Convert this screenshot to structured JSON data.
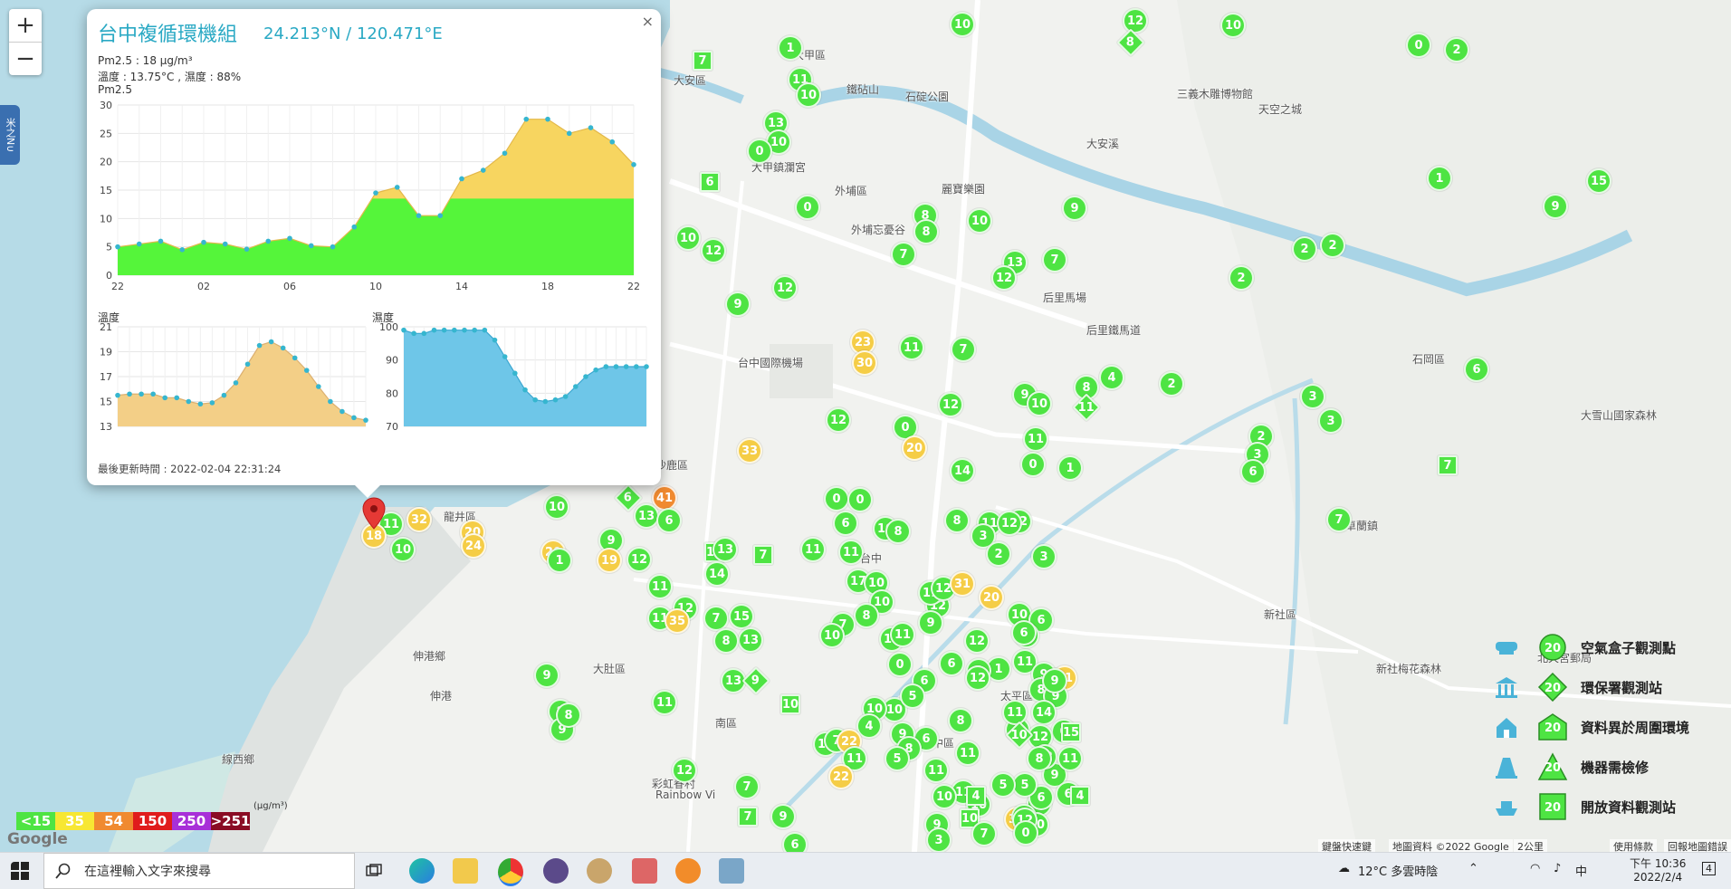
{
  "colors": {
    "green": "#4ee443",
    "yellow": "#f5cd46",
    "orange": "#f08a30",
    "red": "#e01c1c",
    "purple": "#a830d8",
    "maroon": "#8a0c24",
    "accent": "#2aa9c4"
  },
  "zoom": {
    "in": "+",
    "out": "−"
  },
  "side_tab": "米之N∪",
  "popup": {
    "title": "台中複循環機組",
    "coords": "24.213°N / 120.471°E",
    "pm": "Pm2.5 : 18 μg/m³",
    "tempHum": "溫度 : 13.75°C , 濕度 : 88%",
    "pmLabel": "Pm2.5",
    "tempLabel": "溫度",
    "humLabel": "濕度",
    "updated": "最後更新時間 : 2022-02-04 22:31:24",
    "close": "×"
  },
  "chart_data": [
    {
      "type": "area",
      "title": "Pm2.5",
      "ylim": [
        0,
        30
      ],
      "yticks": [
        0,
        5,
        10,
        15,
        20,
        25,
        30
      ],
      "xticks": [
        "22",
        "02",
        "06",
        "10",
        "14",
        "18",
        "22"
      ],
      "threshold": 13.5,
      "values": [
        5,
        5.5,
        6,
        4.5,
        5.8,
        5.5,
        4.6,
        6,
        6.5,
        5.2,
        5,
        8.5,
        14.5,
        15.5,
        10.5,
        10.5,
        17,
        18.5,
        21.5,
        27.5,
        27.5,
        25,
        26,
        23.5,
        19.5
      ]
    },
    {
      "type": "area",
      "title": "溫度",
      "ylim": [
        13,
        21
      ],
      "yticks": [
        13,
        15,
        17,
        19,
        21
      ],
      "values": [
        15.5,
        15.6,
        15.6,
        15.6,
        15.3,
        15.3,
        15,
        14.8,
        14.9,
        15.5,
        16.5,
        18,
        19.5,
        19.8,
        19.3,
        18.5,
        17.5,
        16.2,
        15,
        14.2,
        13.7,
        13.5
      ]
    },
    {
      "type": "area",
      "title": "濕度",
      "ylim": [
        70,
        100
      ],
      "yticks": [
        70,
        80,
        90,
        100
      ],
      "values": [
        99,
        98,
        98,
        99,
        99,
        99,
        99,
        99,
        99,
        96,
        91,
        86,
        81,
        78,
        77.5,
        78,
        79,
        82,
        85,
        87,
        88,
        88,
        88,
        88,
        88
      ]
    }
  ],
  "map_labels": [
    {
      "t": "大甲區"
    },
    {
      "t": "大安區"
    },
    {
      "t": "石岡區"
    },
    {
      "t": "外埔區"
    },
    {
      "t": "后里馬場"
    },
    {
      "t": "后里鐵馬道"
    },
    {
      "t": "台中國際機場"
    },
    {
      "t": "沙鹿區"
    },
    {
      "t": "龍井區"
    },
    {
      "t": "大肚區"
    },
    {
      "t": "伸港鄉"
    },
    {
      "t": "伸港"
    },
    {
      "t": "線西鄉"
    },
    {
      "t": "新社區"
    },
    {
      "t": "卓蘭鎮"
    },
    {
      "t": "彩虹眷村"
    },
    {
      "t": "Rainbow Vi"
    },
    {
      "t": "大雪山國家森林"
    },
    {
      "t": "北天宮郵局"
    },
    {
      "t": "太平區"
    },
    {
      "t": "台中"
    },
    {
      "t": "南區"
    },
    {
      "t": "中區"
    },
    {
      "t": "新社梅花森林"
    },
    {
      "t": "天空之城"
    },
    {
      "t": "三義木雕博物館"
    },
    {
      "t": "大安溪"
    },
    {
      "t": "鐵砧山"
    },
    {
      "t": "石碇公園"
    },
    {
      "t": "外埔忘憂谷"
    },
    {
      "t": "麗寶樂園"
    },
    {
      "t": "大甲鎮瀾宮"
    }
  ],
  "markers": [
    {
      "v": "10",
      "c": "g"
    },
    {
      "v": "7",
      "c": "g",
      "s": "sq"
    },
    {
      "v": "1",
      "c": "g"
    },
    {
      "v": "11",
      "c": "g"
    },
    {
      "v": "10",
      "c": "g"
    },
    {
      "v": "12",
      "c": "g"
    },
    {
      "v": "8",
      "c": "g",
      "s": "dm"
    },
    {
      "v": "10",
      "c": "g"
    },
    {
      "v": "0",
      "c": "g"
    },
    {
      "v": "2",
      "c": "g"
    },
    {
      "v": "13",
      "c": "g"
    },
    {
      "v": "10",
      "c": "g"
    },
    {
      "v": "0",
      "c": "g"
    },
    {
      "v": "6",
      "c": "g",
      "s": "sq"
    },
    {
      "v": "1",
      "c": "g"
    },
    {
      "v": "15",
      "c": "g"
    },
    {
      "v": "9",
      "c": "g"
    },
    {
      "v": "0",
      "c": "g"
    },
    {
      "v": "8",
      "c": "g"
    },
    {
      "v": "10",
      "c": "g"
    },
    {
      "v": "9",
      "c": "g"
    },
    {
      "v": "10",
      "c": "g"
    },
    {
      "v": "12",
      "c": "g"
    },
    {
      "v": "7",
      "c": "g"
    },
    {
      "v": "8",
      "c": "g"
    },
    {
      "v": "13",
      "c": "g"
    },
    {
      "v": "7",
      "c": "g"
    },
    {
      "v": "12",
      "c": "g"
    },
    {
      "v": "2",
      "c": "g"
    },
    {
      "v": "2",
      "c": "g"
    },
    {
      "v": "2",
      "c": "g"
    },
    {
      "v": "9",
      "c": "g"
    },
    {
      "v": "12",
      "c": "g"
    },
    {
      "v": "23",
      "c": "y"
    },
    {
      "v": "30",
      "c": "y"
    },
    {
      "v": "11",
      "c": "g"
    },
    {
      "v": "7",
      "c": "g"
    },
    {
      "v": "6",
      "c": "g"
    },
    {
      "v": "12",
      "c": "g"
    },
    {
      "v": "12",
      "c": "g"
    },
    {
      "v": "0",
      "c": "g"
    },
    {
      "v": "20",
      "c": "y"
    },
    {
      "v": "9",
      "c": "g"
    },
    {
      "v": "10",
      "c": "g"
    },
    {
      "v": "8",
      "c": "g"
    },
    {
      "v": "4",
      "c": "g"
    },
    {
      "v": "11",
      "c": "g",
      "s": "dm"
    },
    {
      "v": "2",
      "c": "g"
    },
    {
      "v": "3",
      "c": "g"
    },
    {
      "v": "3",
      "c": "g"
    },
    {
      "v": "33",
      "c": "y"
    },
    {
      "v": "14",
      "c": "g"
    },
    {
      "v": "11",
      "c": "g"
    },
    {
      "v": "0",
      "c": "g"
    },
    {
      "v": "1",
      "c": "g"
    },
    {
      "v": "2",
      "c": "g"
    },
    {
      "v": "3",
      "c": "g"
    },
    {
      "v": "6",
      "c": "g"
    },
    {
      "v": "7",
      "c": "g",
      "s": "sq"
    },
    {
      "v": "41",
      "c": "o"
    },
    {
      "v": "6",
      "c": "g",
      "s": "dm"
    },
    {
      "v": "13",
      "c": "g"
    },
    {
      "v": "6",
      "c": "g"
    },
    {
      "v": "10",
      "c": "g"
    },
    {
      "v": "0",
      "c": "g"
    },
    {
      "v": "0",
      "c": "g"
    },
    {
      "v": "6",
      "c": "g"
    },
    {
      "v": "12",
      "c": "g"
    },
    {
      "v": "10",
      "c": "g"
    },
    {
      "v": "8",
      "c": "g"
    },
    {
      "v": "8",
      "c": "g"
    },
    {
      "v": "11",
      "c": "g"
    },
    {
      "v": "12",
      "c": "g"
    },
    {
      "v": "3",
      "c": "g"
    },
    {
      "v": "2",
      "c": "g"
    },
    {
      "v": "3",
      "c": "g"
    },
    {
      "v": "7",
      "c": "g"
    },
    {
      "v": "32",
      "c": "y"
    },
    {
      "v": "11",
      "c": "g"
    },
    {
      "v": "18",
      "c": "y"
    },
    {
      "v": "10",
      "c": "g",
      "s": "sq"
    },
    {
      "v": "20",
      "c": "y"
    },
    {
      "v": "24",
      "c": "y"
    },
    {
      "v": "10",
      "c": "g"
    },
    {
      "v": "9",
      "c": "g"
    },
    {
      "v": "20",
      "c": "y"
    },
    {
      "v": "19",
      "c": "y"
    },
    {
      "v": "13",
      "c": "g"
    },
    {
      "v": "14",
      "c": "g"
    },
    {
      "v": "7",
      "c": "g",
      "s": "sq"
    },
    {
      "v": "1",
      "c": "g"
    },
    {
      "v": "12",
      "c": "g"
    },
    {
      "v": "11",
      "c": "g"
    },
    {
      "v": "12",
      "c": "g"
    },
    {
      "v": "11",
      "c": "g"
    },
    {
      "v": "12",
      "c": "g"
    },
    {
      "v": "11",
      "c": "g"
    },
    {
      "v": "35",
      "c": "y"
    },
    {
      "v": "7",
      "c": "g"
    },
    {
      "v": "15",
      "c": "g"
    },
    {
      "v": "13",
      "c": "g"
    },
    {
      "v": "8",
      "c": "g"
    },
    {
      "v": "11",
      "c": "g"
    },
    {
      "v": "17",
      "c": "g"
    },
    {
      "v": "10",
      "c": "g"
    },
    {
      "v": "10",
      "c": "g"
    },
    {
      "v": "8",
      "c": "g"
    },
    {
      "v": "7",
      "c": "g"
    },
    {
      "v": "10",
      "c": "g"
    },
    {
      "v": "11",
      "c": "g"
    },
    {
      "v": "12",
      "c": "g"
    },
    {
      "v": "31",
      "c": "y"
    },
    {
      "v": "20",
      "c": "y"
    },
    {
      "v": "10",
      "c": "g"
    },
    {
      "v": "6",
      "c": "g"
    },
    {
      "v": "5",
      "c": "g"
    },
    {
      "v": "12",
      "c": "g"
    },
    {
      "v": "14",
      "c": "g"
    },
    {
      "v": "9",
      "c": "g"
    },
    {
      "v": "9",
      "c": "g"
    },
    {
      "v": "13",
      "c": "g"
    },
    {
      "v": "9",
      "c": "g",
      "s": "dm"
    },
    {
      "v": "10",
      "c": "g",
      "s": "sq"
    },
    {
      "v": "6",
      "c": "g"
    },
    {
      "v": "11",
      "c": "g"
    },
    {
      "v": "11",
      "c": "g"
    },
    {
      "v": "0",
      "c": "g"
    },
    {
      "v": "1",
      "c": "g"
    },
    {
      "v": "6",
      "c": "g"
    },
    {
      "v": "9",
      "c": "g"
    },
    {
      "v": "10",
      "c": "g"
    },
    {
      "v": "5",
      "c": "g"
    },
    {
      "v": "6",
      "c": "g"
    },
    {
      "v": "3",
      "c": "g"
    },
    {
      "v": "4",
      "c": "g"
    },
    {
      "v": "21",
      "c": "y"
    },
    {
      "v": "8",
      "c": "g"
    },
    {
      "v": "9",
      "c": "g"
    },
    {
      "v": "14",
      "c": "g"
    },
    {
      "v": "9",
      "c": "g"
    },
    {
      "v": "11",
      "c": "g"
    },
    {
      "v": "8",
      "c": "g"
    },
    {
      "v": "9",
      "c": "g"
    },
    {
      "v": "8",
      "c": "g"
    },
    {
      "v": "12",
      "c": "g"
    },
    {
      "v": "11",
      "c": "g"
    },
    {
      "v": "6",
      "c": "g"
    },
    {
      "v": "8",
      "c": "g"
    },
    {
      "v": "12",
      "c": "g"
    },
    {
      "v": "10",
      "c": "g"
    },
    {
      "v": "4",
      "c": "g"
    },
    {
      "v": "7",
      "c": "g"
    },
    {
      "v": "22",
      "c": "y"
    },
    {
      "v": "11",
      "c": "g"
    },
    {
      "v": "22",
      "c": "y"
    },
    {
      "v": "9",
      "c": "g"
    },
    {
      "v": "8",
      "c": "g"
    },
    {
      "v": "5",
      "c": "g"
    },
    {
      "v": "11",
      "c": "g"
    },
    {
      "v": "0",
      "c": "g"
    },
    {
      "v": "15",
      "c": "g",
      "s": "sq"
    },
    {
      "v": "12",
      "c": "g"
    },
    {
      "v": "10",
      "c": "g",
      "s": "dm"
    },
    {
      "v": "9",
      "c": "g"
    },
    {
      "v": "12",
      "c": "g"
    },
    {
      "v": "11",
      "c": "g"
    },
    {
      "v": "10",
      "c": "g"
    },
    {
      "v": "11",
      "c": "g"
    },
    {
      "v": "11",
      "c": "g"
    },
    {
      "v": "10",
      "c": "g"
    },
    {
      "v": "8",
      "c": "g"
    },
    {
      "v": "6",
      "c": "g"
    },
    {
      "v": "10",
      "c": "g",
      "s": "sq"
    },
    {
      "v": "9",
      "c": "g"
    },
    {
      "v": "7",
      "c": "g"
    },
    {
      "v": "3",
      "c": "g"
    },
    {
      "v": "32",
      "c": "y"
    },
    {
      "v": "10",
      "c": "g"
    },
    {
      "v": "11",
      "c": "g"
    },
    {
      "v": "4",
      "c": "g",
      "s": "sq"
    },
    {
      "v": "8",
      "c": "g"
    },
    {
      "v": "6",
      "c": "g"
    },
    {
      "v": "12",
      "c": "g"
    },
    {
      "v": "5",
      "c": "g"
    },
    {
      "v": "4",
      "c": "g",
      "s": "sq"
    },
    {
      "v": "12",
      "c": "g"
    },
    {
      "v": "9",
      "c": "g"
    },
    {
      "v": "6",
      "c": "g"
    },
    {
      "v": "7",
      "c": "g",
      "s": "sq"
    },
    {
      "v": "7",
      "c": "g"
    },
    {
      "v": "5",
      "c": "g"
    },
    {
      "v": "0",
      "c": "g"
    }
  ],
  "legend": [
    {
      "label": "空氣盒子觀測點",
      "badge": "20",
      "shape": "circle"
    },
    {
      "label": "環保署觀測站",
      "badge": "20",
      "shape": "diamond"
    },
    {
      "label": "資料異於周圍環境",
      "badge": "20",
      "shape": "house"
    },
    {
      "label": "機器需檢修",
      "badge": "20",
      "shape": "triangle"
    },
    {
      "label": "開放資料觀測站",
      "badge": "20",
      "shape": "square"
    }
  ],
  "scale": [
    {
      "t": "<15",
      "color": "#4ee443",
      "fg": "#fff"
    },
    {
      "t": "35",
      "color": "#f7e733",
      "fg": "#fff"
    },
    {
      "t": "54",
      "color": "#f08a30",
      "fg": "#fff"
    },
    {
      "t": "150",
      "color": "#e01c1c",
      "fg": "#fff"
    },
    {
      "t": "250",
      "color": "#a830d8",
      "fg": "#fff"
    },
    {
      "t": ">251",
      "color": "#8a0c24",
      "fg": "#fff"
    }
  ],
  "unit": "(μg/m³)",
  "google": "Google",
  "attribution": {
    "shortcuts": "鍵盤快速鍵",
    "mapdata": "地圖資料 ©2022 Google",
    "scale": "2公里",
    "terms": "使用條款",
    "report": "回報地圖錯誤"
  },
  "taskbar": {
    "search_placeholder": "在這裡輸入文字來搜尋",
    "weather": "12°C  多雲時陰",
    "ime": "中",
    "time": "下午 10:36",
    "date": "2022/2/4",
    "notify": "4"
  }
}
